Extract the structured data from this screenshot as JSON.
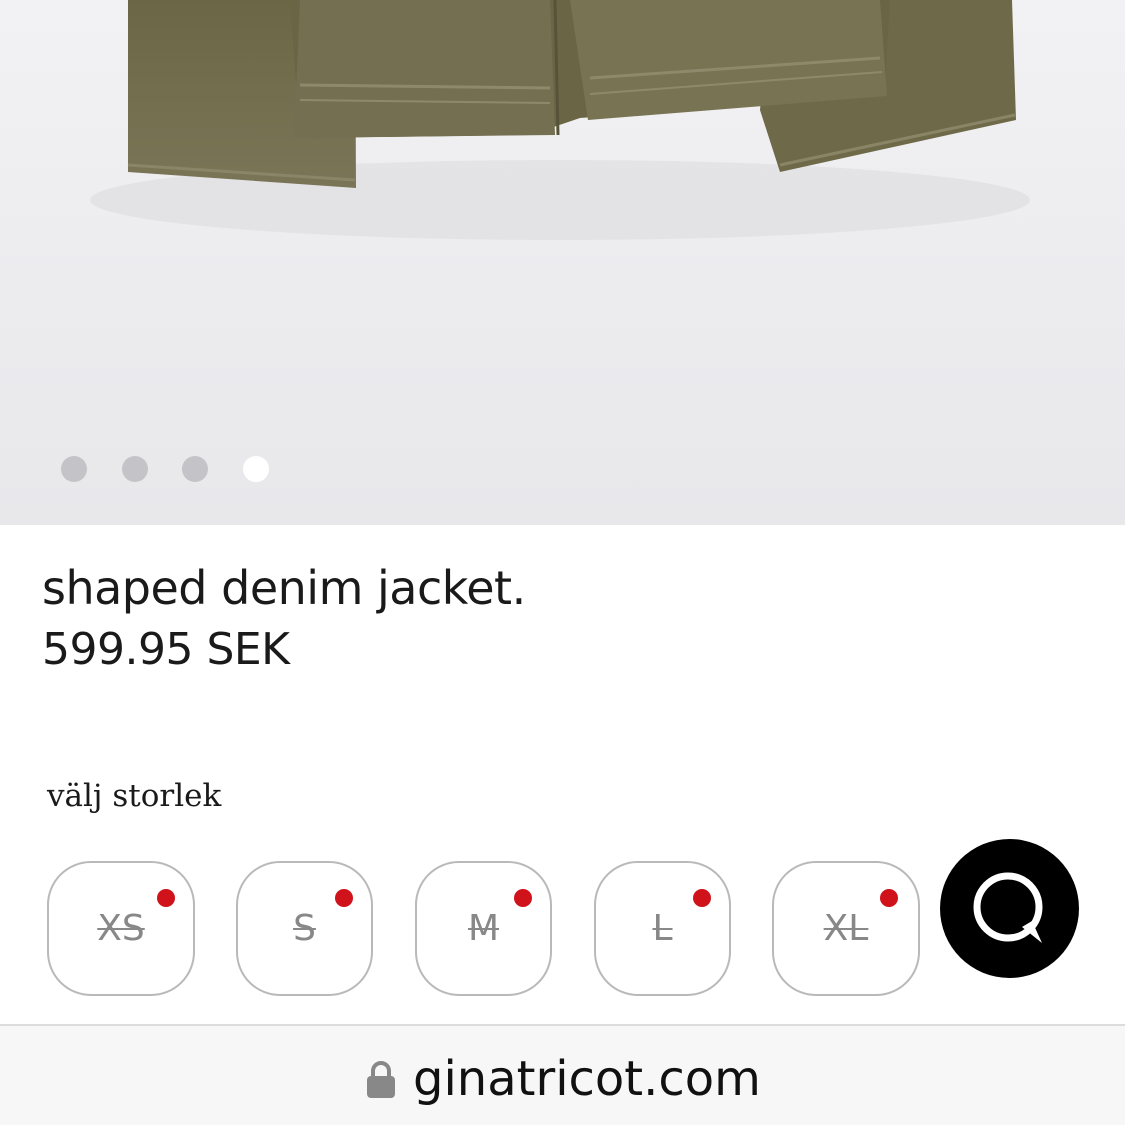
{
  "product": {
    "title": "shaped denim jacket.",
    "price": "599.95 SEK",
    "image": {
      "description_icon": "jacket-photo",
      "dots_total": 4,
      "active_dot": 4
    }
  },
  "sizes": {
    "label": "välj storlek",
    "options": [
      {
        "label": "XS",
        "available": false
      },
      {
        "label": "S",
        "available": false
      },
      {
        "label": "M",
        "available": false
      },
      {
        "label": "L",
        "available": false
      },
      {
        "label": "XL",
        "available": false
      }
    ]
  },
  "chat": {
    "icon": "chat-bubble-icon"
  },
  "browser": {
    "url": "ginatricot.com",
    "lock_icon": "lock-icon"
  },
  "colors": {
    "out_of_stock": "#d0121b",
    "chat_bg": "#000000",
    "jacket": "#6f6a4a"
  }
}
